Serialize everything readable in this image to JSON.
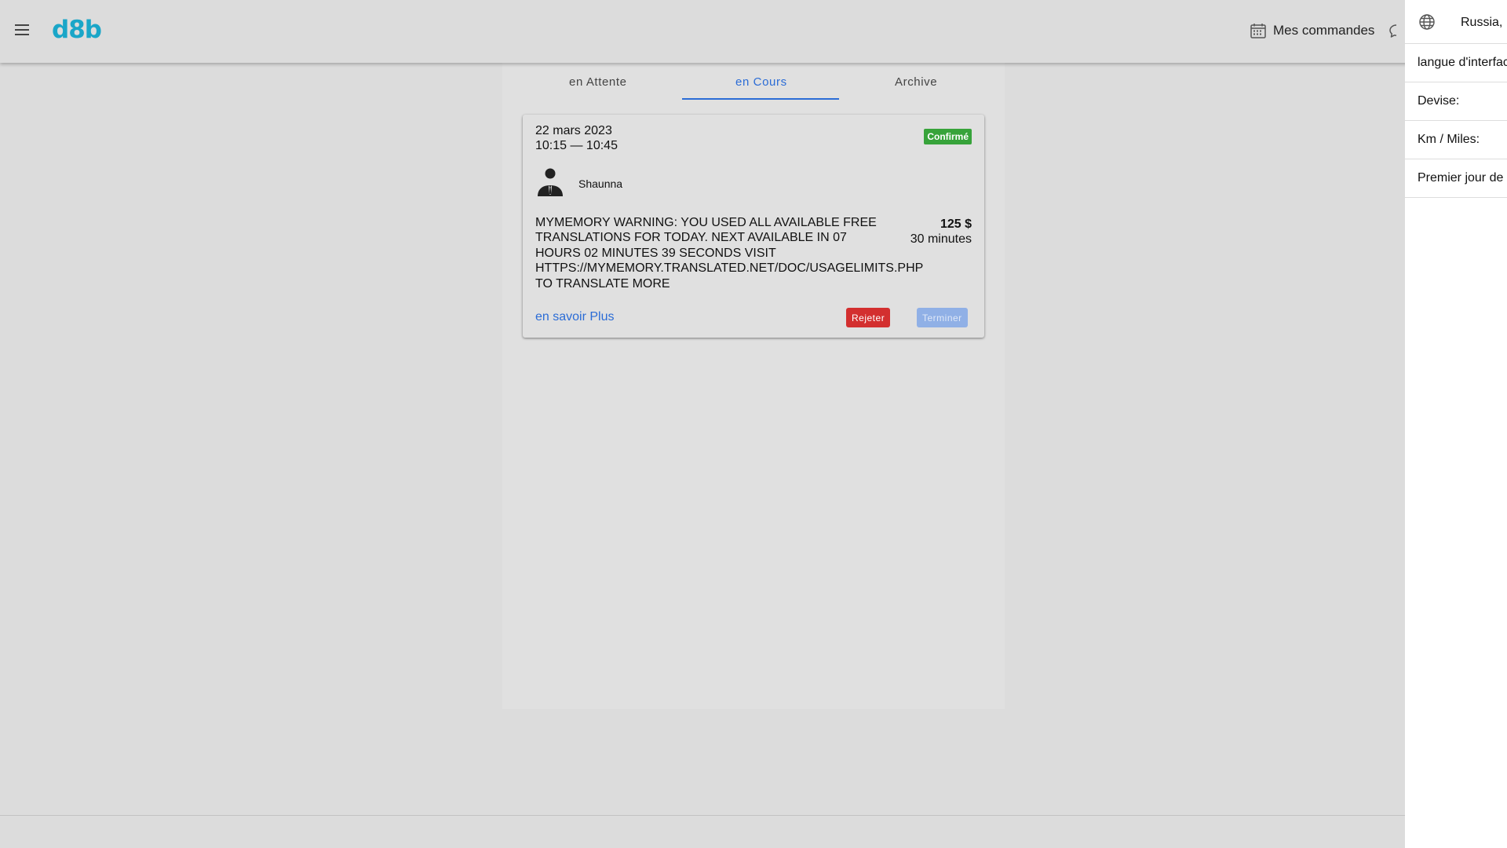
{
  "header": {
    "logo": "d8b",
    "orders_label": "Mes commandes"
  },
  "tabs": [
    {
      "label": "en Attente",
      "active": false
    },
    {
      "label": "en Cours",
      "active": true
    },
    {
      "label": "Archive",
      "active": false
    }
  ],
  "order_card": {
    "date": "22 mars 2023",
    "time": "10:15 — 10:45",
    "status": "Confirmé",
    "client_name": "Shaunna",
    "description": "MYMEMORY WARNING: YOU USED ALL AVAILABLE FREE TRANSLATIONS FOR TODAY. NEXT AVAILABLE IN 07 HOURS 02 MINUTES 39 SECONDS VISIT HTTPS://MYMEMORY.TRANSLATED.NET/DOC/USAGELIMITS.PHP TO TRANSLATE MORE",
    "price": "125 $",
    "duration": "30 minutes",
    "more_link": "en savoir Plus",
    "reject_label": "Rejeter",
    "finish_label": "Terminer"
  },
  "drawer": {
    "country": "Russia, I",
    "rows": [
      {
        "label": "langue d'interface"
      },
      {
        "label": "Devise:"
      },
      {
        "label": "Km / Miles:"
      },
      {
        "label": "Premier jour de la"
      }
    ]
  },
  "colors": {
    "accent": "#2b6cd6",
    "logo": "#1aa6c8",
    "confirmed_badge": "#37a33a",
    "reject_button": "#d32f2f",
    "finish_button": "#90b0e6"
  }
}
